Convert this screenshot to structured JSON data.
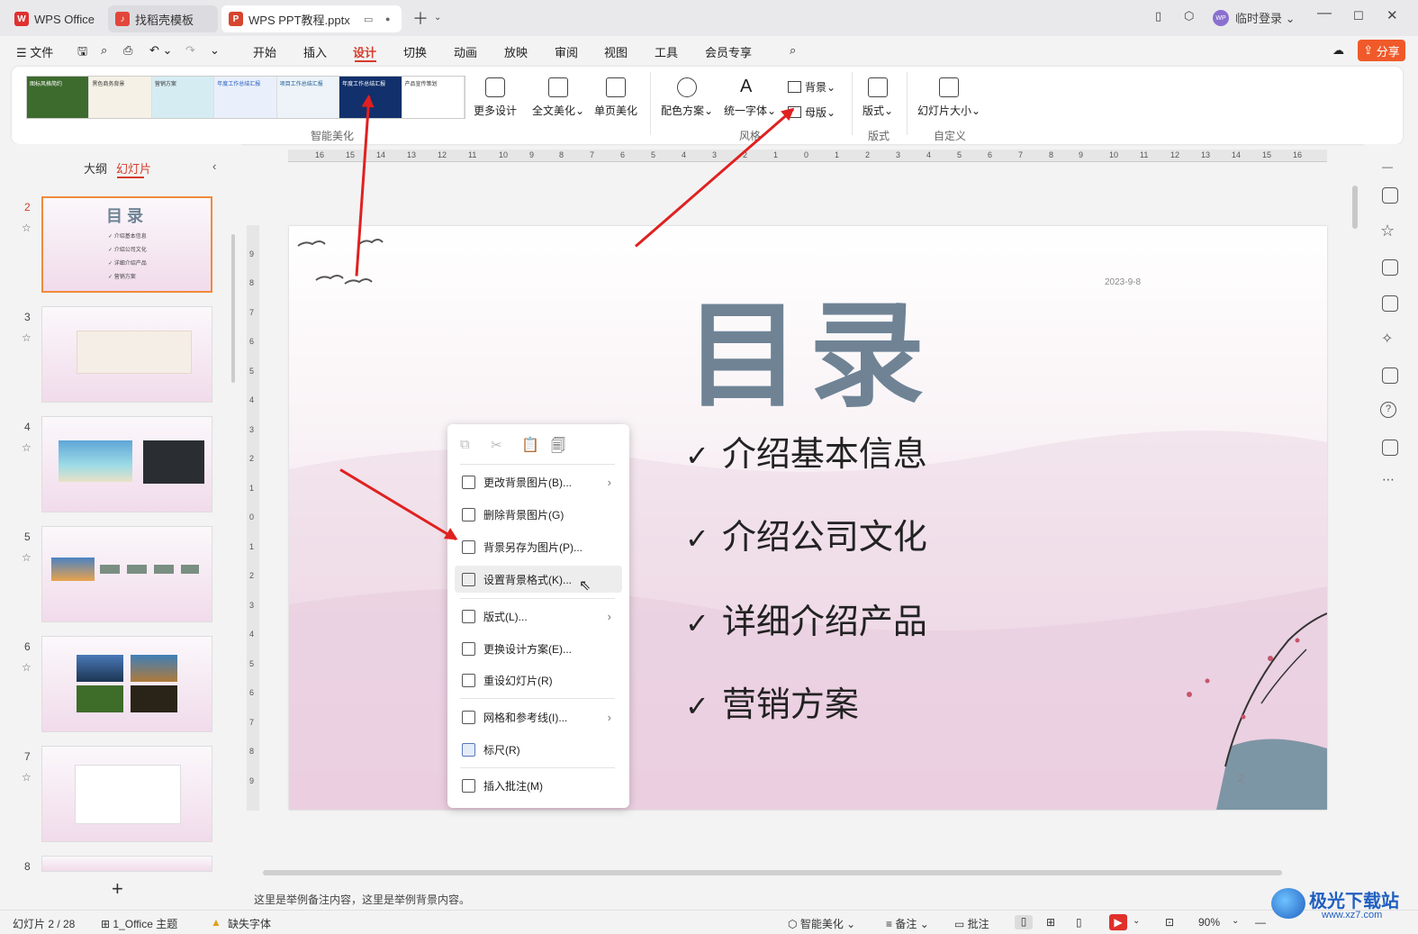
{
  "tabs": [
    {
      "label": "WPS Office"
    },
    {
      "label": "找稻壳模板"
    },
    {
      "label": "WPS PPT教程.pptx"
    }
  ],
  "titlebar": {
    "login": "临时登录",
    "avatar": "WP"
  },
  "menu": {
    "file": "文件",
    "items": [
      "开始",
      "插入",
      "设计",
      "切换",
      "动画",
      "放映",
      "审阅",
      "视图",
      "工具",
      "会员专享"
    ],
    "share": "分享"
  },
  "ribbon": {
    "more_design": "更多设计",
    "full_beautify": "全文美化",
    "single_beautify": "单页美化",
    "color_scheme": "配色方案",
    "unify_font": "统一字体",
    "background": "背景",
    "master": "母版",
    "layout": "版式",
    "slide_size": "幻灯片大小",
    "group_smart": "智能美化",
    "group_style": "风格",
    "group_layout": "版式",
    "group_custom": "自定义",
    "thumbs": [
      "图标风格简约",
      "黑色商务背景",
      "营销方案",
      "年度工作总结汇报",
      "项目工作总结汇报",
      "年度工作总结汇报",
      "产品宣传策划"
    ]
  },
  "leftpanel": {
    "outline": "大纲",
    "slides": "幻灯片",
    "add": "+"
  },
  "thumbs": [
    {
      "num": "2",
      "title": "目 录"
    },
    {
      "num": "3"
    },
    {
      "num": "4"
    },
    {
      "num": "5"
    },
    {
      "num": "6"
    },
    {
      "num": "7"
    },
    {
      "num": "8"
    }
  ],
  "slide": {
    "title": "目录",
    "date": "2023-9-8",
    "bullets": [
      "介绍基本信息",
      "介绍公司文化",
      "详细介绍产品",
      "营销方案"
    ],
    "check": "✓",
    "page": "2"
  },
  "ruler": {
    "h_labels": [
      "16",
      "15",
      "14",
      "13",
      "12",
      "11",
      "10",
      "9",
      "8",
      "7",
      "6",
      "5",
      "4",
      "3",
      "2",
      "1",
      "0",
      "1",
      "2",
      "3",
      "4",
      "5",
      "6",
      "7",
      "8",
      "9",
      "10",
      "11",
      "12",
      "13",
      "14",
      "15",
      "16"
    ],
    "v_labels": [
      "9",
      "8",
      "7",
      "6",
      "5",
      "4",
      "3",
      "2",
      "1",
      "0",
      "1",
      "2",
      "3",
      "4",
      "5",
      "6",
      "7",
      "8",
      "9"
    ]
  },
  "context_menu": {
    "items": [
      {
        "label": "更改背景图片(B)...",
        "sub": true
      },
      {
        "label": "删除背景图片(G)",
        "sub": false
      },
      {
        "label": "背景另存为图片(P)...",
        "sub": false
      },
      {
        "label": "设置背景格式(K)...",
        "sub": false
      },
      {
        "label": "版式(L)...",
        "sub": true
      },
      {
        "label": "更换设计方案(E)...",
        "sub": false
      },
      {
        "label": "重设幻灯片(R)",
        "sub": false
      },
      {
        "label": "网格和参考线(I)...",
        "sub": true
      },
      {
        "label": "标尺(R)",
        "sub": false
      },
      {
        "label": "插入批注(M)",
        "sub": false
      }
    ]
  },
  "notes": "这里是举例备注内容，这里是举例背景内容。",
  "status": {
    "slide_count": "幻灯片 2 / 28",
    "theme": "1_Office 主题",
    "missing_font": "缺失字体",
    "smart": "智能美化",
    "notes": "备注",
    "comments": "批注",
    "zoom": "90%"
  },
  "watermark": {
    "text": "极光下载站",
    "url": "www.xz7.com"
  },
  "colors": {
    "accent": "#d63c2b",
    "share": "#f05a2a",
    "title": "#6f8395",
    "arrow": "#e02020"
  }
}
